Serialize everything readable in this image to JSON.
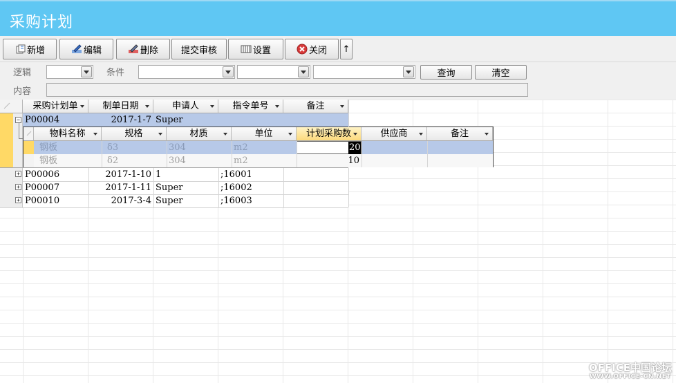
{
  "window": {
    "title": "采购计划"
  },
  "toolbar": {
    "add": "新增",
    "edit": "编辑",
    "delete": "删除",
    "submit": "提交审核",
    "settings": "设置",
    "close": "关闭",
    "up": "↑"
  },
  "filter": {
    "logic_label": "逻辑",
    "condition_label": "条件",
    "content_label": "内容",
    "query_button": "查询",
    "clear_button": "清空"
  },
  "main_grid": {
    "columns": [
      "采购计划单",
      "制单日期",
      "申请人",
      "指令单号",
      "备注"
    ],
    "rows": [
      {
        "id": "P00004",
        "date": "2017-1-7",
        "applicant": "Super",
        "order": "",
        "note": "",
        "expanded": true
      },
      {
        "id": "P00006",
        "date": "2017-1-10",
        "applicant": "1",
        "order": ";16001",
        "note": ""
      },
      {
        "id": "P00007",
        "date": "2017-1-11",
        "applicant": "Super",
        "order": ";16002",
        "note": ""
      },
      {
        "id": "P00010",
        "date": "2017-3-4",
        "applicant": "Super",
        "order": ";16003",
        "note": ""
      }
    ]
  },
  "detail_grid": {
    "columns": [
      "物料名称",
      "规格",
      "材质",
      "单位",
      "计划采购数",
      "供应商",
      "备注"
    ],
    "rows": [
      {
        "name": "钢板",
        "spec": "δ3",
        "material": "304",
        "unit": "m2",
        "qty": "20",
        "supplier": "",
        "note": ""
      },
      {
        "name": "钢板",
        "spec": "δ2",
        "material": "304",
        "unit": "m2",
        "qty": "10",
        "supplier": "",
        "note": ""
      }
    ]
  },
  "watermark": {
    "line1": "OFFICE中国论坛",
    "line2": "WWW.OFFICE-CN.NET"
  },
  "colors": {
    "title_bar": "#5fc7f3",
    "selected_row": "#b7c9e8",
    "active_header": "#fcd97c"
  }
}
